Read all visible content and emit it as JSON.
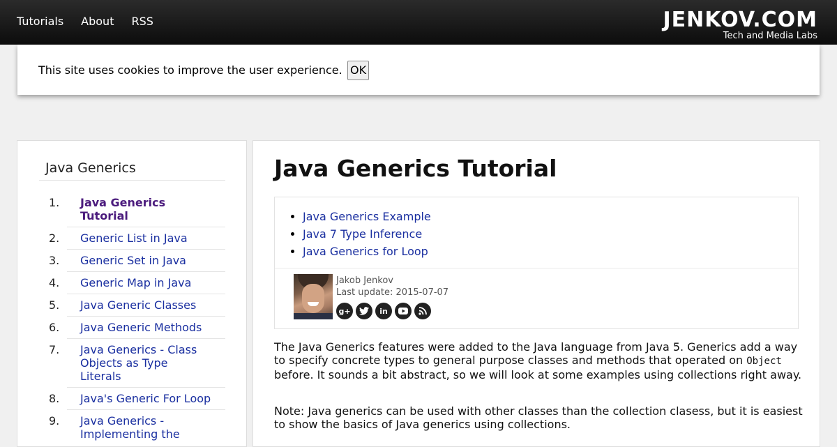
{
  "topbar": {
    "nav": [
      "Tutorials",
      "About",
      "RSS"
    ],
    "logo": "JENKOV.COM",
    "tagline": "Tech and Media Labs"
  },
  "cookie": {
    "text": "This site uses cookies to improve the user experience.",
    "button": "OK"
  },
  "sidebar": {
    "title": "Java Generics",
    "items": [
      {
        "num": "1.",
        "label": "Java Generics Tutorial",
        "active": true
      },
      {
        "num": "2.",
        "label": "Generic List in Java"
      },
      {
        "num": "3.",
        "label": "Generic Set in Java"
      },
      {
        "num": "4.",
        "label": "Generic Map in Java"
      },
      {
        "num": "5.",
        "label": "Java Generic Classes"
      },
      {
        "num": "6.",
        "label": "Java Generic Methods"
      },
      {
        "num": "7.",
        "label": "Java Generics - Class Objects as Type Literals"
      },
      {
        "num": "8.",
        "label": "Java's Generic For Loop"
      },
      {
        "num": "9.",
        "label": "Java Generics - Implementing the"
      }
    ]
  },
  "main": {
    "title": "Java Generics Tutorial",
    "sublinks": [
      "Java Generics Example",
      "Java 7 Type Inference",
      "Java Generics for Loop"
    ],
    "author": "Jakob Jenkov",
    "last_update": "Last update: 2015-07-07",
    "social": [
      "g+",
      "twitter",
      "in",
      "youtube",
      "rss"
    ],
    "para1_a": "The Java Generics features were added to the Java language from Java 5. Generics add a way to specify concrete types to general purpose classes and methods that operated on",
    "para1_code": "Object",
    "para1_b": "before. It sounds a bit abstract, so we will look at some examples using collections right away.",
    "para2": "Note: Java generics can be used with other classes than the collection clasess, but it is easiest to show the basics of Java generics using collections."
  }
}
